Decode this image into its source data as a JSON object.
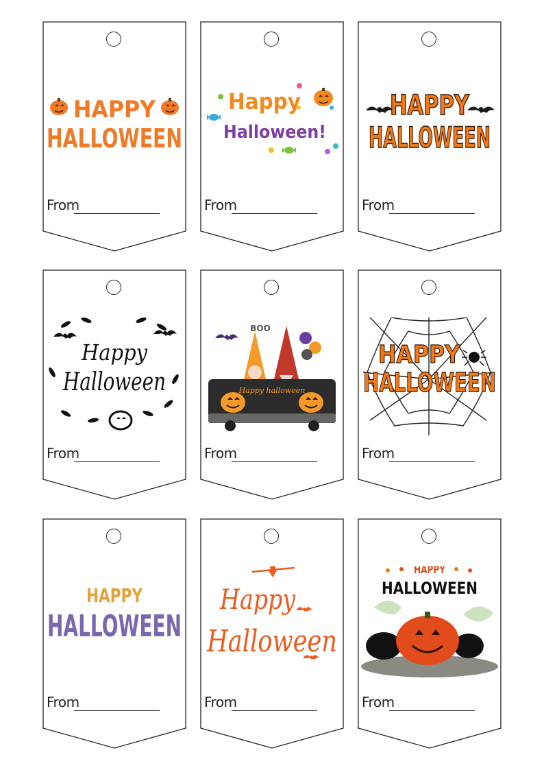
{
  "tags": [
    {
      "title_line1": "HAPPY",
      "title_line2": "HALLOWEEN",
      "from_label": "From",
      "colors": {
        "main": "#f07a28"
      }
    },
    {
      "title_line1": "Happy",
      "title_line2": "Halloween!",
      "colors": {
        "main": "#f28a1e",
        "second": "#7a3fa0"
      },
      "from_label": "From"
    },
    {
      "title_line1": "HAPPY",
      "title_line2": "HALLOWEEN",
      "from_label": "From",
      "colors": {
        "main": "#f07a1a"
      }
    },
    {
      "title_line1": "Happy",
      "title_line2": "Halloween",
      "from_label": "From",
      "colors": {
        "main": "#111111"
      }
    },
    {
      "title_line1": "BOO",
      "title_line2": "Happy halloween",
      "from_label": "From",
      "colors": {
        "main": "#f39a2a"
      }
    },
    {
      "title_line1": "HAPPY",
      "title_line2": "HALLOWEEN",
      "from_label": "From",
      "colors": {
        "main": "#f07a1a"
      }
    },
    {
      "title_line1": "HAPPY",
      "title_line2": "HALLOWEEN",
      "from_label": "From",
      "colors": {
        "main": "#e3a23a",
        "second": "#7a67ad"
      }
    },
    {
      "title_line1": "Happy",
      "title_line2": "Halloween",
      "from_label": "From",
      "colors": {
        "main": "#ee5a1c"
      }
    },
    {
      "title_line1": "HAPPY",
      "title_line2": "HALLOWEEN",
      "from_label": "From",
      "colors": {
        "main": "#e24b1c"
      }
    }
  ]
}
